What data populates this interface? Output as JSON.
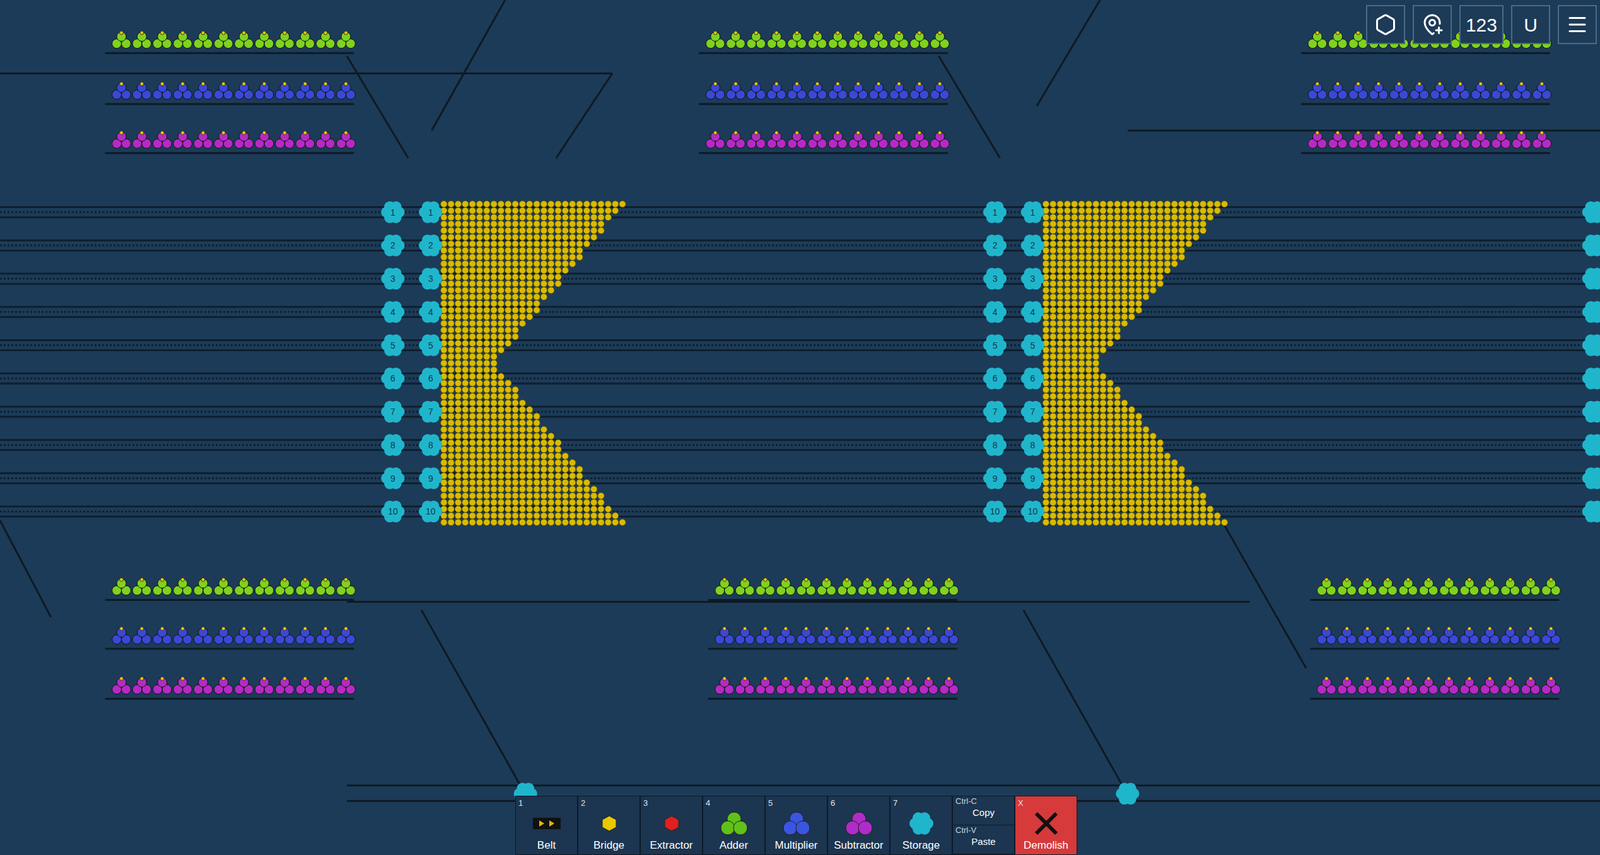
{
  "top_bar": {
    "buttons": [
      {
        "kind": "icon",
        "name": "hexagon",
        "text": ""
      },
      {
        "kind": "icon",
        "name": "map-pin-plus",
        "text": ""
      },
      {
        "kind": "text",
        "name": "numbers",
        "text": "123"
      },
      {
        "kind": "text",
        "name": "upgrades",
        "text": "U"
      },
      {
        "kind": "icon",
        "name": "menu",
        "text": ""
      }
    ]
  },
  "machine_kinds": [
    {
      "kind": "adder",
      "color": "#7fd21f"
    },
    {
      "kind": "multiplier",
      "color": "#3a48d6"
    },
    {
      "kind": "subtractor",
      "color": "#b52ac4"
    }
  ],
  "storage_columns": [
    {
      "labels_visible": true,
      "labels": [
        "1",
        "2",
        "3",
        "4",
        "5",
        "6",
        "7",
        "8",
        "9",
        "10"
      ]
    },
    {
      "labels_visible": true,
      "labels": [
        "1",
        "2",
        "3",
        "4",
        "5",
        "6",
        "7",
        "8",
        "9",
        "10"
      ]
    },
    {
      "labels_visible": true,
      "labels": [
        "1",
        "2",
        "3",
        "4",
        "5",
        "6",
        "7",
        "8",
        "9",
        "10"
      ]
    },
    {
      "labels_visible": true,
      "labels": [
        "1",
        "2",
        "3",
        "4",
        "5",
        "6",
        "7",
        "8",
        "9",
        "10"
      ]
    },
    {
      "labels_visible": false,
      "labels": [
        "",
        "",
        "",
        "",
        "",
        "",
        "",
        "",
        "",
        ""
      ]
    }
  ],
  "toolbar": [
    {
      "key": "1",
      "label": "Belt",
      "kind": "belt",
      "color": "#e0b800",
      "selected": false
    },
    {
      "key": "2",
      "label": "Bridge",
      "kind": "bridge",
      "color": "#e8c800",
      "selected": false
    },
    {
      "key": "3",
      "label": "Extractor",
      "kind": "extractor",
      "color": "#e02020",
      "selected": false
    },
    {
      "key": "4",
      "label": "Adder",
      "kind": "trefoil",
      "color": "#5fc21a",
      "selected": false
    },
    {
      "key": "5",
      "label": "Multiplier",
      "kind": "trefoil",
      "color": "#3a55e0",
      "selected": false
    },
    {
      "key": "6",
      "label": "Subtractor",
      "kind": "trefoil",
      "color": "#b02cc8",
      "selected": false
    },
    {
      "key": "7",
      "label": "Storage",
      "kind": "storage",
      "color": "#1fb6cc",
      "selected": false
    },
    {
      "key": "Ctrl-C",
      "label": "Copy",
      "kind": "split",
      "color": "",
      "selected": false,
      "second": {
        "key": "Ctrl-V",
        "label": "Paste"
      }
    },
    {
      "key": "X",
      "label": "Demolish",
      "kind": "demolish",
      "color": "#d63a3a",
      "selected": false
    }
  ]
}
